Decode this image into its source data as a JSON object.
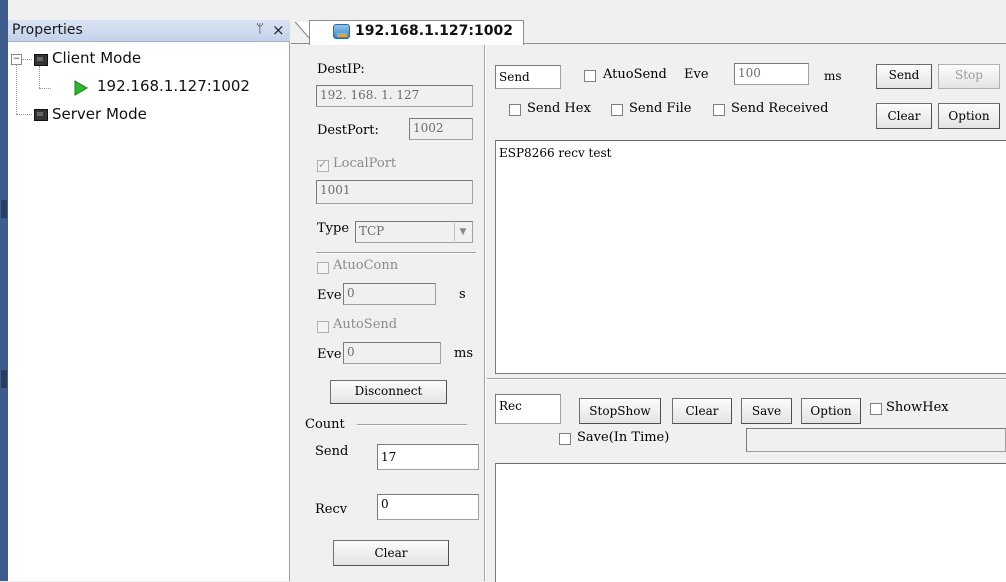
{
  "properties_panel": {
    "title": "Properties",
    "pin": "ᛘ",
    "close": "×",
    "tree": {
      "client_mode": "Client Mode",
      "client_item": "192.168.1.127:1002",
      "server_mode": "Server Mode",
      "expand_symbol": "−"
    }
  },
  "tab": {
    "label": "192.168.1.127:1002"
  },
  "settings": {
    "dest_ip_label": "DestIP:",
    "dest_ip_value": "192. 168. 1. 127",
    "dest_port_label": "DestPort:",
    "dest_port_value": "1002",
    "local_port_label": "LocalPort",
    "local_port_value": "1001",
    "type_label": "Type",
    "type_value": "TCP",
    "auto_conn_label": "AtuoConn",
    "eve_label": "Eve",
    "eve1_value": "0",
    "eve1_unit": "s",
    "auto_send_label": "AutoSend",
    "eve2_value": "0",
    "eve2_unit": "ms",
    "disconnect_label": "Disconnect",
    "count_label": "Count",
    "send_label": "Send",
    "send_value": "17",
    "recv_label": "Recv",
    "recv_value": "0",
    "clear_label": "Clear"
  },
  "send_panel": {
    "send_title": "Send",
    "auto_send_label": "AtuoSend",
    "eve_label": "Eve",
    "eve_value": "100",
    "eve_unit": "ms",
    "send_button": "Send",
    "stop_button": "Stop",
    "send_hex": "Send Hex",
    "send_file": "Send File",
    "send_received": "Send Received",
    "clear_button": "Clear",
    "option_button": "Option",
    "content": "ESP8266 recv test"
  },
  "recv_panel": {
    "rec_title": "Rec",
    "stop_show": "StopShow",
    "clear": "Clear",
    "save": "Save",
    "option": "Option",
    "show_hex": "ShowHex",
    "save_in_time": "Save(In Time)",
    "content": ""
  }
}
